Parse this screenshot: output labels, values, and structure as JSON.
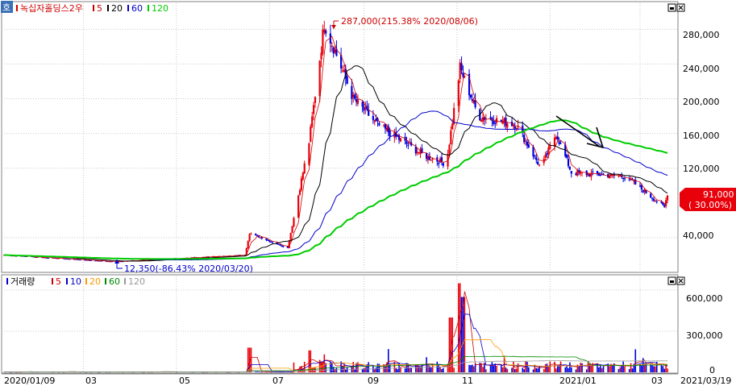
{
  "price_panel": {
    "corner_label": "호",
    "legend": [
      {
        "text": "녹십자홀딩스2우",
        "color": "#cc0000"
      },
      {
        "text": "5",
        "color": "#cc0000"
      },
      {
        "text": "20",
        "color": "#000000"
      },
      {
        "text": "60",
        "color": "#0000cc"
      },
      {
        "text": "120",
        "color": "#00cc00"
      }
    ],
    "high_annotation": "287,000(215.38% 2020/08/06)",
    "low_annotation": "12,350(-86.43% 2020/03/20)",
    "last_price_label": "91,000",
    "last_change_label": "( 30.00%)",
    "y_ticks": [
      "280,000",
      "240,000",
      "200,000",
      "160,000",
      "120,000",
      "40,000"
    ]
  },
  "volume_panel": {
    "legend": [
      {
        "text": "거래량",
        "color": "#000000"
      },
      {
        "text": "5",
        "color": "#cc0000"
      },
      {
        "text": "10",
        "color": "#0000cc"
      },
      {
        "text": "20",
        "color": "#ff9900"
      },
      {
        "text": "60",
        "color": "#008800"
      },
      {
        "text": "120",
        "color": "#999999"
      }
    ],
    "y_ticks": [
      "600,000",
      "300,000",
      "0"
    ]
  },
  "x_axis": {
    "labels": [
      "2020/01/09",
      "03",
      "05",
      "07",
      "09",
      "11",
      "2021/01",
      "03"
    ],
    "end_label": "2021/03/19"
  },
  "colors": {
    "up": "#e8000b",
    "down": "#0000dd",
    "ma5": "#cc0000",
    "ma20": "#000000",
    "ma60": "#0000cc",
    "ma120": "#00cc00",
    "grid": "#c8c8c8"
  },
  "chart_data": {
    "type": "candlestick",
    "x_range": [
      "2020/01/09",
      "2021/03/19"
    ],
    "price_ylim": [
      0,
      310000
    ],
    "price_key_points": [
      {
        "date": "2020/01/09",
        "close": 20000
      },
      {
        "date": "2020/03/20",
        "close": 12350
      },
      {
        "date": "2020/06/15",
        "close": 20000
      },
      {
        "date": "2020/06/18",
        "close": 45000
      },
      {
        "date": "2020/07/13",
        "close": 28000
      },
      {
        "date": "2020/07/27",
        "close": 150000
      },
      {
        "date": "2020/08/06",
        "close": 287000
      },
      {
        "date": "2020/08/25",
        "close": 200000
      },
      {
        "date": "2020/09/10",
        "close": 170000
      },
      {
        "date": "2020/10/10",
        "close": 135000
      },
      {
        "date": "2020/10/25",
        "close": 125000
      },
      {
        "date": "2020/11/03",
        "close": 236000
      },
      {
        "date": "2020/11/15",
        "close": 180000
      },
      {
        "date": "2020/12/10",
        "close": 170000
      },
      {
        "date": "2020/12/26",
        "close": 120000
      },
      {
        "date": "2021/01/05",
        "close": 160000
      },
      {
        "date": "2021/01/15",
        "close": 115000
      },
      {
        "date": "2021/02/20",
        "close": 110000
      },
      {
        "date": "2021/03/17",
        "close": 75000
      },
      {
        "date": "2021/03/19",
        "close": 91000
      }
    ],
    "volume_ylim": [
      0,
      700000
    ],
    "volume_key_points": [
      {
        "date": "2020/06/18",
        "value": 180000
      },
      {
        "date": "2020/07/27",
        "value": 160000
      },
      {
        "date": "2020/10/28",
        "value": 400000
      },
      {
        "date": "2020/11/03",
        "value": 650000
      },
      {
        "date": "2020/11/05",
        "value": 550000
      }
    ]
  }
}
